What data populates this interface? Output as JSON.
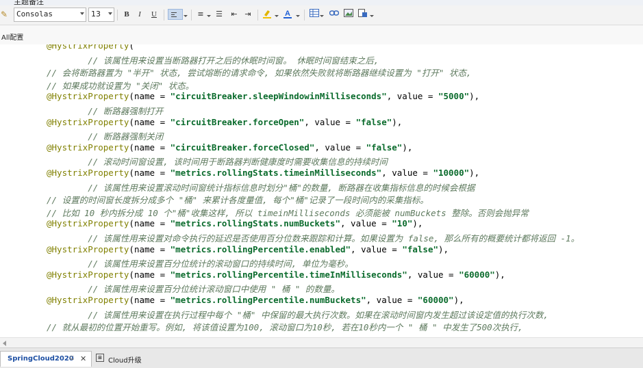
{
  "window": {
    "title": "主题备注"
  },
  "toolbar": {
    "font_name": "Consolas",
    "font_size": "13",
    "bold_label": "B",
    "italic_label": "I",
    "underline_label": "U",
    "highlight_color": "#f2c200",
    "font_color": "#1f5fd6"
  },
  "breadcrumb": {
    "label": "All配置"
  },
  "code": {
    "lines": [
      {
        "parts": [
          {
            "t": "an",
            "v": "@HystrixProperty"
          },
          {
            "t": "pl",
            "v": "("
          }
        ]
      },
      {
        "parts": [
          {
            "t": "cm",
            "v": "        // 该属性用来设置当断路器打开之后的休眠时间窗。 休眠时间窗结束之后,"
          }
        ]
      },
      {
        "parts": [
          {
            "t": "cm",
            "v": "// 会将断路器置为 \"半开\" 状态, 尝试熔断的请求命令, 如果依然失败就将断路器继续设置为 \"打开\" 状态,"
          }
        ]
      },
      {
        "parts": [
          {
            "t": "cm",
            "v": "// 如果成功就设置为 \"关闭\" 状态。"
          }
        ]
      },
      {
        "parts": [
          {
            "t": "an",
            "v": "@HystrixProperty"
          },
          {
            "t": "pl",
            "v": "(name = "
          },
          {
            "t": "st",
            "v": "\"circuitBreaker.sleepWindowinMilliseconds\""
          },
          {
            "t": "pl",
            "v": ", value = "
          },
          {
            "t": "st",
            "v": "\"5000\""
          },
          {
            "t": "pl",
            "v": "),"
          }
        ]
      },
      {
        "parts": [
          {
            "t": "cm",
            "v": "        // 断路器强制打开"
          }
        ]
      },
      {
        "parts": [
          {
            "t": "an",
            "v": "@HystrixProperty"
          },
          {
            "t": "pl",
            "v": "(name = "
          },
          {
            "t": "st",
            "v": "\"circuitBreaker.forceOpen\""
          },
          {
            "t": "pl",
            "v": ", value = "
          },
          {
            "t": "st",
            "v": "\"false\""
          },
          {
            "t": "pl",
            "v": "),"
          }
        ]
      },
      {
        "parts": [
          {
            "t": "cm",
            "v": "        // 断路器强制关闭"
          }
        ]
      },
      {
        "parts": [
          {
            "t": "an",
            "v": "@HystrixProperty"
          },
          {
            "t": "pl",
            "v": "(name = "
          },
          {
            "t": "st",
            "v": "\"circuitBreaker.forceClosed\""
          },
          {
            "t": "pl",
            "v": ", value = "
          },
          {
            "t": "st",
            "v": "\"false\""
          },
          {
            "t": "pl",
            "v": "),"
          }
        ]
      },
      {
        "parts": [
          {
            "t": "cm",
            "v": "        // 滚动时间窗设置, 该时间用于断路器判断健康度时需要收集信息的持续时间"
          }
        ]
      },
      {
        "parts": [
          {
            "t": "an",
            "v": "@HystrixProperty"
          },
          {
            "t": "pl",
            "v": "(name = "
          },
          {
            "t": "st",
            "v": "\"metrics.rollingStats.timeinMilliseconds\""
          },
          {
            "t": "pl",
            "v": ", value = "
          },
          {
            "t": "st",
            "v": "\"10000\""
          },
          {
            "t": "pl",
            "v": "),"
          }
        ]
      },
      {
        "parts": [
          {
            "t": "cm",
            "v": "        // 该属性用来设置滚动时间窗统计指标信息时划分\"桶\"的数量, 断路器在收集指标信息的时候会根据"
          }
        ]
      },
      {
        "parts": [
          {
            "t": "cm",
            "v": "// 设置的时间窗长度拆分成多个 \"桶\" 来累计各度量值, 每个\"桶\"记录了一段时间内的采集指标。"
          }
        ]
      },
      {
        "parts": [
          {
            "t": "cm",
            "v": "// 比如 10 秒内拆分成 10 个\"桶\"收集这样, 所以 timeinMilliseconds 必须能被 numBuckets 整除。否则会抛异常"
          }
        ]
      },
      {
        "parts": [
          {
            "t": "an",
            "v": "@HystrixProperty"
          },
          {
            "t": "pl",
            "v": "(name = "
          },
          {
            "t": "st",
            "v": "\"metrics.rollingStats.numBuckets\""
          },
          {
            "t": "pl",
            "v": ", value = "
          },
          {
            "t": "st",
            "v": "\"10\""
          },
          {
            "t": "pl",
            "v": "),"
          }
        ]
      },
      {
        "parts": [
          {
            "t": "cm",
            "v": "        // 该属性用来设置对命令执行的延迟是否使用百分位数来跟踪和计算。如果设置为 false, 那么所有的概要统计都将返回 -1。"
          }
        ]
      },
      {
        "parts": [
          {
            "t": "an",
            "v": "@HystrixProperty"
          },
          {
            "t": "pl",
            "v": "(name = "
          },
          {
            "t": "st",
            "v": "\"metrics.rollingPercentile.enabled\""
          },
          {
            "t": "pl",
            "v": ", value = "
          },
          {
            "t": "st",
            "v": "\"false\""
          },
          {
            "t": "pl",
            "v": "),"
          }
        ]
      },
      {
        "parts": [
          {
            "t": "cm",
            "v": "        // 该属性用来设置百分位统计的滚动窗口的持续时间, 单位为毫秒。"
          }
        ]
      },
      {
        "parts": [
          {
            "t": "an",
            "v": "@HystrixProperty"
          },
          {
            "t": "pl",
            "v": "(name = "
          },
          {
            "t": "st",
            "v": "\"metrics.rollingPercentile.timeInMilliseconds\""
          },
          {
            "t": "pl",
            "v": ", value = "
          },
          {
            "t": "st",
            "v": "\"60000\""
          },
          {
            "t": "pl",
            "v": "),"
          }
        ]
      },
      {
        "parts": [
          {
            "t": "cm",
            "v": "        // 该属性用来设置百分位统计滚动窗口中使用 \" 桶 \" 的数量。"
          }
        ]
      },
      {
        "parts": [
          {
            "t": "an",
            "v": "@HystrixProperty"
          },
          {
            "t": "pl",
            "v": "(name = "
          },
          {
            "t": "st",
            "v": "\"metrics.rollingPercentile.numBuckets\""
          },
          {
            "t": "pl",
            "v": ", value = "
          },
          {
            "t": "st",
            "v": "\"60000\""
          },
          {
            "t": "pl",
            "v": "),"
          }
        ]
      },
      {
        "parts": [
          {
            "t": "cm",
            "v": "        // 该属性用来设置在执行过程中每个 \"桶\" 中保留的最大执行次数。如果在滚动时间窗内发生超过该设定值的执行次数,"
          }
        ]
      },
      {
        "parts": [
          {
            "t": "cm",
            "v": "// 就从最初的位置开始重写。例如, 将该值设置为100, 滚动窗口为10秒, 若在10秒内一个 \" 桶 \" 中发生了500次执行,"
          }
        ]
      }
    ]
  },
  "tabs": [
    {
      "label": "SpringCloud2020",
      "pin": "⊊",
      "close": "✕"
    },
    {
      "label": "Cloud升级",
      "icon": "⊞"
    }
  ]
}
